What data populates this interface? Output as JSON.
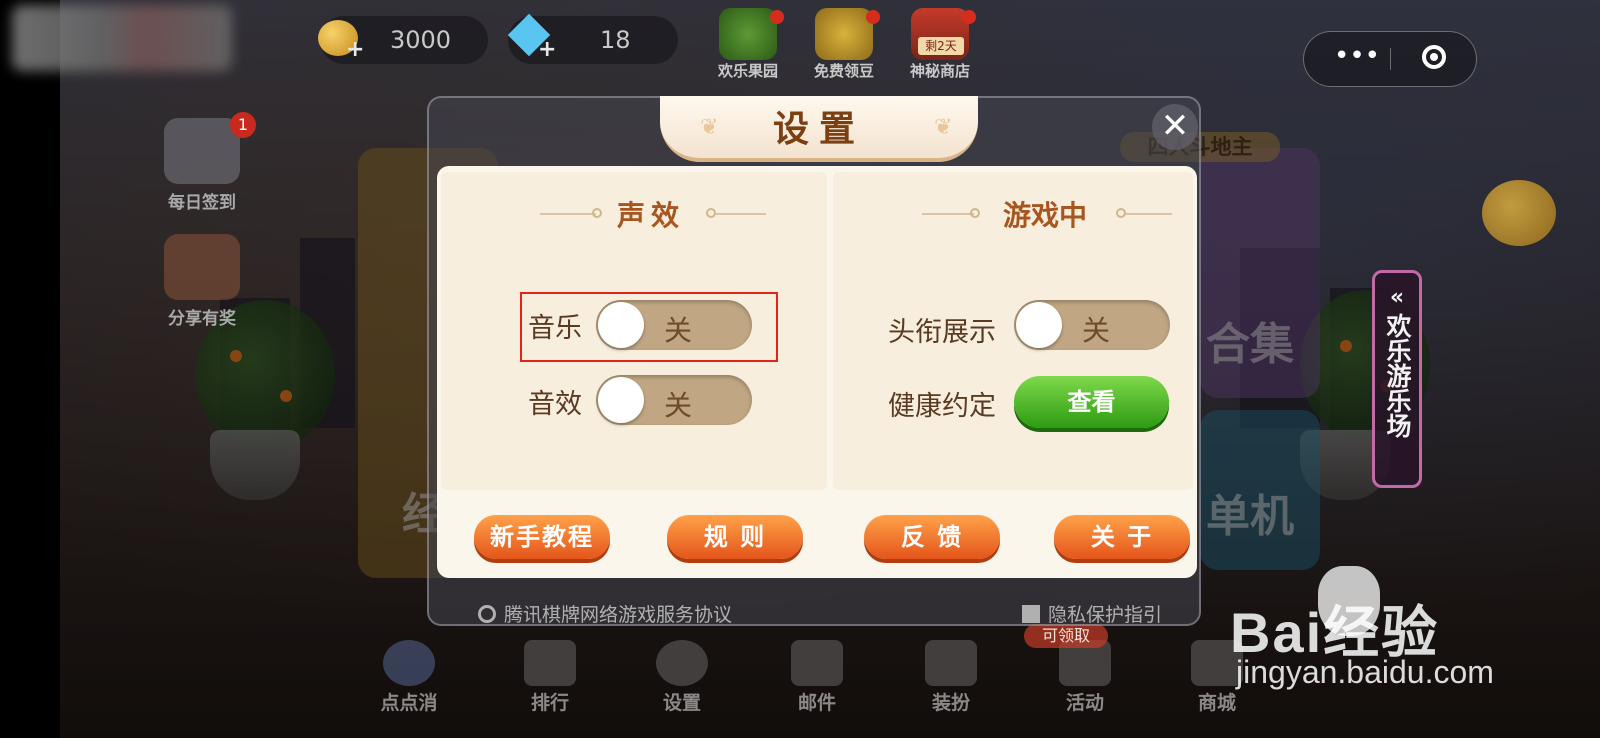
{
  "topbar": {
    "coins": "3000",
    "gems": "18",
    "icons": [
      {
        "label": "欢乐果园"
      },
      {
        "label": "免费领豆"
      },
      {
        "label": "神秘商店",
        "tag": "剩2天"
      }
    ]
  },
  "side": {
    "daily_checkin": "每日签到",
    "daily_badge": "1",
    "share": "分享有奖"
  },
  "background": {
    "card_label_left": "经",
    "card_label_collection": "合集",
    "card_label_single": "单机",
    "four_player_tag": "四人斗地主",
    "vertical_banner": "欢乐游乐场"
  },
  "dialog": {
    "title": "设置",
    "sound": {
      "header": "声效",
      "music_label": "音乐",
      "music_state": "关",
      "sfx_label": "音效",
      "sfx_state": "关"
    },
    "ingame": {
      "header": "游戏中",
      "title_display_label": "头衔展示",
      "title_display_state": "关",
      "health_label": "健康约定",
      "health_button": "查看"
    },
    "buttons": {
      "tutorial": "新手教程",
      "rules": "规 则",
      "feedback": "反 馈",
      "about": "关 于"
    },
    "footer": {
      "agreement": "腾讯棋牌网络游戏服务协议",
      "privacy": "隐私保护指引"
    }
  },
  "bottom_nav": [
    {
      "label": "点点消"
    },
    {
      "label": "排行"
    },
    {
      "label": "设置"
    },
    {
      "label": "邮件"
    },
    {
      "label": "装扮"
    },
    {
      "label": "活动",
      "tag": "可领取"
    },
    {
      "label": "商城"
    }
  ],
  "watermark": {
    "brand": "Bai经验",
    "url": "jingyan.baidu.com"
  },
  "colors": {
    "toggle_off": "#c0a682",
    "green_button": "#2d9b12",
    "orange_button": "#e4551a",
    "title_brown": "#7b3f12",
    "highlight_red": "#e0251c"
  }
}
